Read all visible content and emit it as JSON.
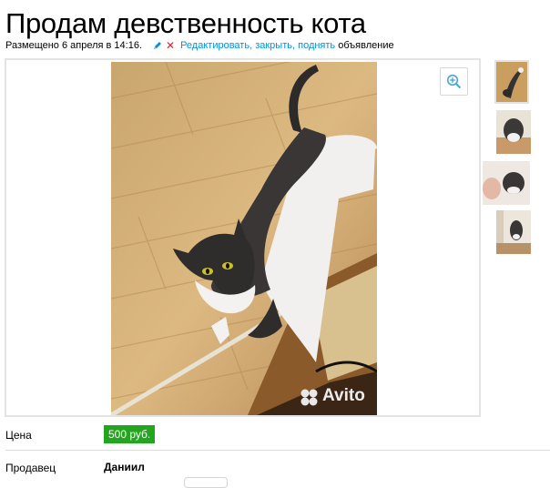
{
  "listing": {
    "title": "Продам девственность кота",
    "posted": "Размещено 6 апреля в 14:16.",
    "actions": {
      "edit": "Редактировать",
      "sep1": ", ",
      "close": "закрыть",
      "sep2": ", ",
      "bump": "поднять",
      "suffix": " объявление"
    }
  },
  "gallery": {
    "watermark": "Avito",
    "zoom_icon": "zoom-in-icon",
    "thumbnails": [
      "cat-photo-1",
      "cat-photo-2",
      "cat-photo-3",
      "cat-photo-4"
    ],
    "active_index": 0
  },
  "details": {
    "price_label": "Цена",
    "price": "500 руб.",
    "seller_label": "Продавец",
    "seller": "Даниил"
  },
  "colors": {
    "link": "#0091d9",
    "price_badge": "#23a51f",
    "close_cross": "#e0242b",
    "border": "#e3e3e3"
  }
}
